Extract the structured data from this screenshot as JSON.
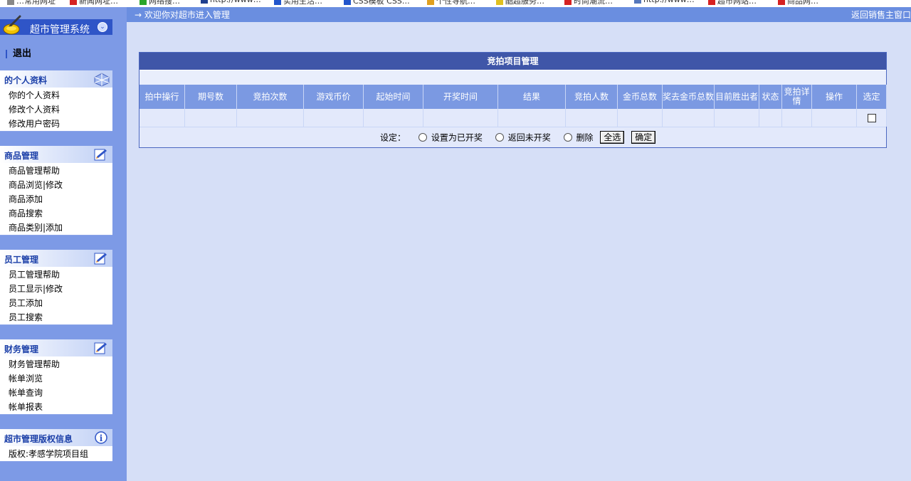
{
  "bookmarks": [
    {
      "label": "…常用网址",
      "color": "#888888"
    },
    {
      "label": "新闻网址…",
      "color": "#d62222"
    },
    {
      "label": "网络搜…",
      "color": "#2aa52a"
    },
    {
      "label": "http://www…",
      "color": "#1f3f8f"
    },
    {
      "label": "实用生活…",
      "color": "#2255cc"
    },
    {
      "label": "CSS模板 CSS…",
      "color": "#2255cc"
    },
    {
      "label": "个性导航…",
      "color": "#e0a020"
    },
    {
      "label": "酷超服务…",
      "color": "#e0c020"
    },
    {
      "label": "时尚潮流…",
      "color": "#d62222"
    },
    {
      "label": "http://www…",
      "color": "#5577bb"
    },
    {
      "label": "超市网站…",
      "color": "#d62222"
    },
    {
      "label": "商品网…",
      "color": "#d62222"
    }
  ],
  "topbar": {
    "welcome": "→  欢迎你对超市进入管理",
    "return_link": "返回销售主窗口"
  },
  "sidebar": {
    "system_title": "超市管理系统",
    "logout": "退出",
    "panels": [
      {
        "title": "的个人资料",
        "icon": "globe-icon",
        "items": [
          "你的个人资料",
          "修改个人资料",
          "修改用户密码"
        ]
      },
      {
        "title": "商品管理",
        "icon": "edit-icon",
        "items": [
          "商品管理帮助",
          "商品浏览|修改",
          "商品添加",
          "商品搜索",
          "商品类别|添加"
        ]
      },
      {
        "title": "员工管理",
        "icon": "edit-icon",
        "items": [
          "员工管理帮助",
          "员工显示|修改",
          "员工添加",
          "员工搜索"
        ]
      },
      {
        "title": "财务管理",
        "icon": "edit-icon",
        "items": [
          "财务管理帮助",
          "帐单浏览",
          "帐单查询",
          "帐单报表"
        ]
      },
      {
        "title": "超市管理版权信息",
        "icon": "info-icon",
        "items": [
          "版权:孝感学院项目组"
        ]
      }
    ]
  },
  "grid": {
    "title": "竞拍项目管理",
    "columns": [
      "拍中操行",
      "期号数",
      "竞拍次数",
      "游戏币价",
      "起始时间",
      "开奖时间",
      "结果",
      "竞拍人数",
      "金币总数",
      "奖去金币总数",
      "目前胜出者",
      "状态",
      "竞拍详情",
      "操作",
      "选定"
    ],
    "settings": {
      "label": "设定：",
      "options": [
        "设置为已开奖",
        "返回未开奖",
        "删除"
      ],
      "select_all": "全选",
      "confirm": "确定"
    }
  },
  "colors": {
    "sidebar_bg": "#7d9ae6",
    "main_bg": "#d6dff7",
    "title_bar": "#3f56a8",
    "header_row": "#7b99e2",
    "panel_title": "#1b3fa8"
  }
}
